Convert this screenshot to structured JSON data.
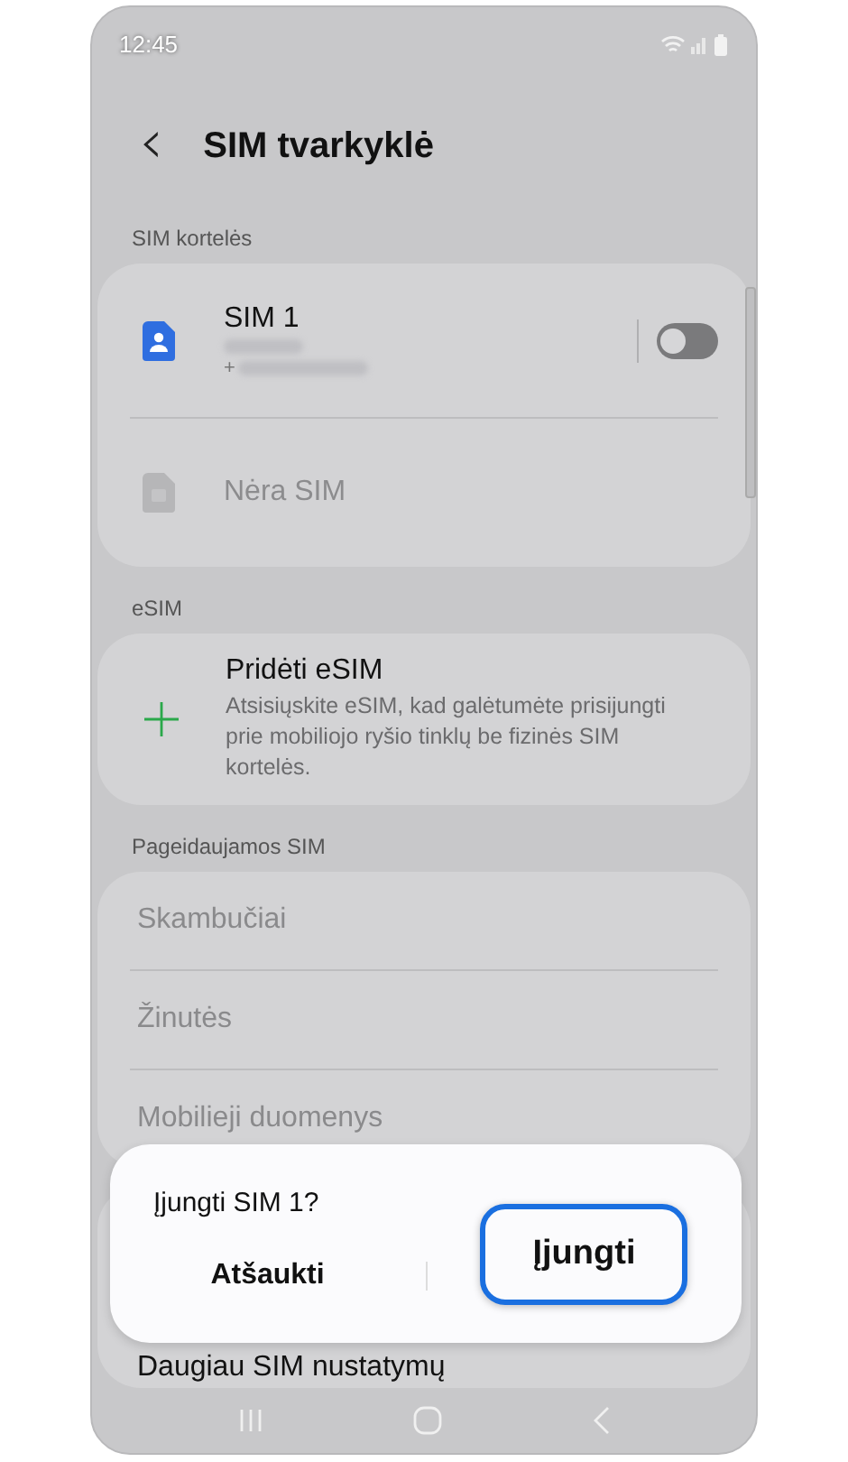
{
  "status_bar": {
    "time": "12:45"
  },
  "header": {
    "back": "‹",
    "title": "SIM tvarkyklė"
  },
  "sim_section": {
    "label": "SIM kortelės",
    "sims": [
      {
        "name": "SIM 1",
        "number_prefix": "+",
        "enabled": true,
        "on": false
      },
      {
        "name": "Nėra SIM",
        "enabled": false
      }
    ]
  },
  "esim_section": {
    "label": "eSIM",
    "add": {
      "title": "Pridėti eSIM",
      "description": "Atsisiųskite eSIM, kad galėtumėte prisijungti prie mobiliojo ryšio tinklų be fizinės SIM kortelės."
    }
  },
  "preferred_section": {
    "label": "Pageidaujamos SIM",
    "items": [
      "Skambučiai",
      "Žinutės",
      "Mobilieji duomenys"
    ]
  },
  "more_settings": "Daugiau SIM nustatymų",
  "dialog": {
    "title": "Įjungti SIM 1?",
    "buttons": [
      {
        "label": "Atšaukti",
        "focused": false
      },
      {
        "label": "Įjungti",
        "focused": true
      }
    ]
  }
}
